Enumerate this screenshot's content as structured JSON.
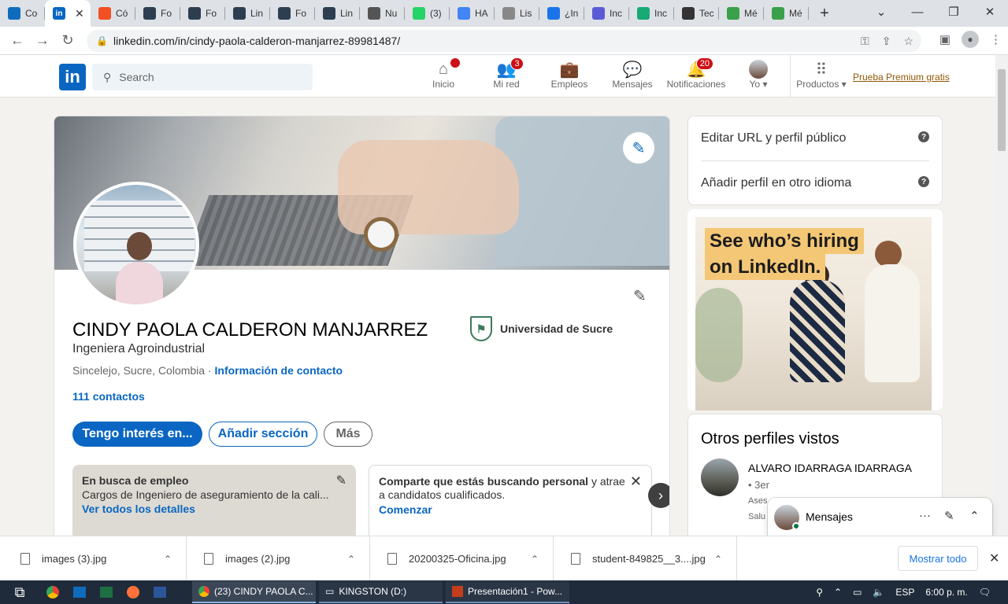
{
  "browser": {
    "tabs": [
      {
        "label": "Co",
        "icon": "outlook-icon",
        "color": "#0f6cbd"
      },
      {
        "label": "",
        "icon": "linkedin-icon",
        "color": "#0a66c2",
        "active": true
      },
      {
        "label": "Có",
        "icon": "microsoft-icon",
        "color": "#f25022"
      },
      {
        "label": "Fo",
        "icon": "academia-icon",
        "color": "#2c3e50"
      },
      {
        "label": "Fo",
        "icon": "academia-icon",
        "color": "#2c3e50"
      },
      {
        "label": "Lin",
        "icon": "academia-icon",
        "color": "#2c3e50"
      },
      {
        "label": "Fo",
        "icon": "academia-icon",
        "color": "#2c3e50"
      },
      {
        "label": "Lin",
        "icon": "academia-icon",
        "color": "#2c3e50"
      },
      {
        "label": "Nu",
        "icon": "github-icon",
        "color": "#555"
      },
      {
        "label": "(3)",
        "icon": "whatsapp-icon",
        "color": "#25d366"
      },
      {
        "label": "HA",
        "icon": "google-icon",
        "color": "#4285f4"
      },
      {
        "label": "Lis",
        "icon": "doc-icon",
        "color": "#888"
      },
      {
        "label": "¿In",
        "icon": "link-icon",
        "color": "#1a73e8"
      },
      {
        "label": "Inc",
        "icon": "link-icon",
        "color": "#5b5bd6"
      },
      {
        "label": "Inc",
        "icon": "bookmark-icon",
        "color": "#19a974"
      },
      {
        "label": "Tec",
        "icon": "tool-icon",
        "color": "#333"
      },
      {
        "label": "Mé",
        "icon": "px-icon",
        "color": "#3aa04a"
      },
      {
        "label": "Mé",
        "icon": "px-icon",
        "color": "#3aa04a"
      }
    ],
    "url": "linkedin.com/in/cindy-paola-calderon-manjarrez-89981487/"
  },
  "linkedin_nav": {
    "search_placeholder": "Search",
    "items": [
      {
        "label": "Inicio",
        "badge": ""
      },
      {
        "label": "Mi red",
        "badge": "3"
      },
      {
        "label": "Empleos",
        "badge": ""
      },
      {
        "label": "Mensajes",
        "badge": ""
      },
      {
        "label": "Notificaciones",
        "badge": "20"
      },
      {
        "label": "Yo ▾",
        "badge": ""
      },
      {
        "label": "Productos ▾",
        "badge": ""
      }
    ],
    "premium": "Prueba Premium gratis"
  },
  "profile": {
    "name": "CINDY PAOLA CALDERON MANJARREZ",
    "headline": "Ingeniera Agroindustrial",
    "location": "Sincelejo, Sucre, Colombia · ",
    "contact_info": "Información de contacto",
    "connections": "111 contactos",
    "university": "Universidad de Sucre",
    "buttons": {
      "interest": "Tengo interés en...",
      "add_section": "Añadir sección",
      "more": "Más"
    },
    "open_to_work": {
      "title": "En busca de empleo",
      "detail": "Cargos de Ingeniero de aseguramiento de la cali...",
      "link": "Ver todos los detalles"
    },
    "hiring": {
      "bold": "Comparte que estás buscando personal",
      "rest": " y atrae a candidatos cualificados.",
      "link": "Comenzar"
    }
  },
  "sidebar": {
    "edit_url": "Editar URL y perfil público",
    "add_language": "Añadir perfil en otro idioma",
    "ad_line1": "See who’s hiring",
    "ad_line2": "on LinkedIn.",
    "other_profiles_title": "Otros perfiles vistos",
    "other_profile": {
      "name": "ALVARO IDARRAGA IDARRAGA",
      "degree": "• 3er",
      "sub1": "Ases",
      "sub2": "Salu"
    }
  },
  "messaging": {
    "label": "Mensajes"
  },
  "downloads": {
    "items": [
      "images (3).jpg",
      "images (2).jpg",
      "20200325-Oficina.jpg",
      "student-849825__3....jpg"
    ],
    "show_all": "Mostrar todo"
  },
  "taskbar": {
    "apps": [
      "(23) CINDY PAOLA C...",
      "KINGSTON (D:)",
      "Presentación1 - Pow..."
    ],
    "lang": "ESP",
    "time": "6:00 p. m."
  }
}
